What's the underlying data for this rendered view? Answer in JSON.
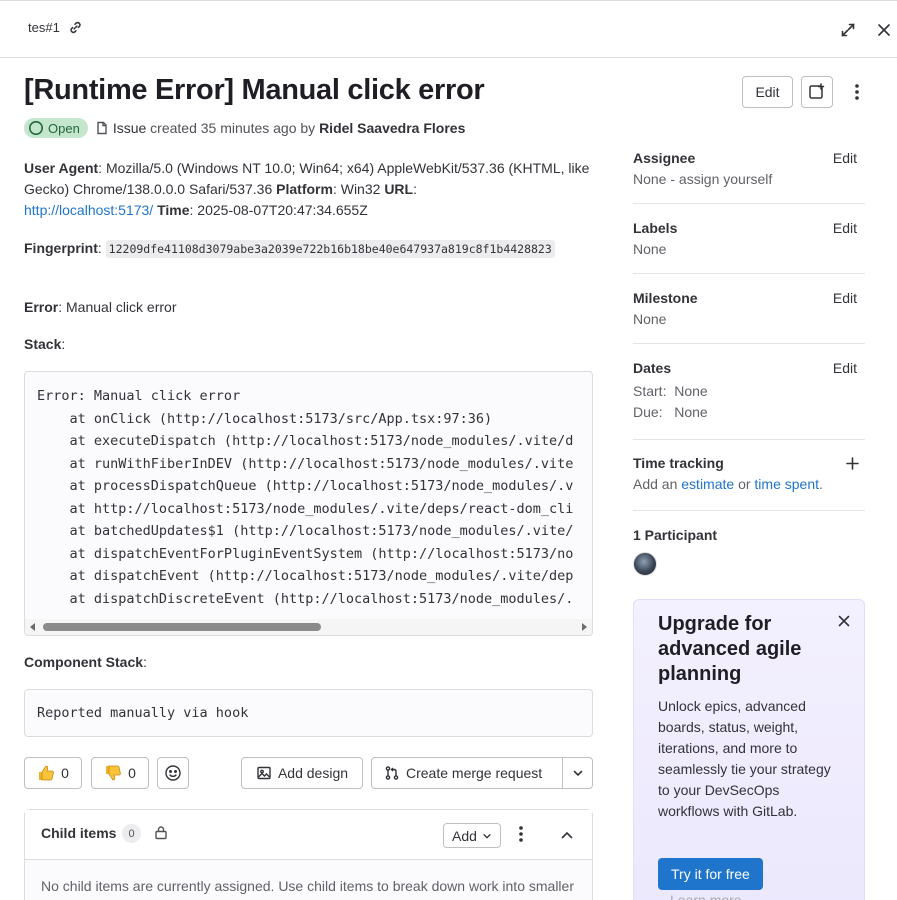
{
  "breadcrumb": {
    "ref": "tes#1"
  },
  "issue": {
    "title": "[Runtime Error] Manual click error",
    "status": "Open",
    "type": "Issue",
    "created_text": "created 35 minutes ago by",
    "author": "Ridel Saavedra Flores"
  },
  "header_buttons": {
    "edit": "Edit"
  },
  "description": {
    "ua_label": "User Agent",
    "ua_value": ": Mozilla/5.0 (Windows NT 10.0; Win64; x64) AppleWebKit/537.36 (KHTML, like Gecko) Chrome/138.0.0.0 Safari/537.36 ",
    "platform_label": "Platform",
    "platform_value": ": Win32 ",
    "url_label": "URL",
    "url_value": "http://localhost:5173/",
    "time_label": "Time",
    "time_value": ": 2025-08-07T20:47:34.655Z",
    "fingerprint_label": "Fingerprint",
    "fingerprint_value": "12209dfe41108d3079abe3a2039e722b16b18be40e647937a819c8f1b4428823",
    "error_label": "Error",
    "error_value": ": Manual click error",
    "stack_label": "Stack",
    "stack_lines": [
      "Error: Manual click error",
      "    at onClick (http://localhost:5173/src/App.tsx:97:36)",
      "    at executeDispatch (http://localhost:5173/node_modules/.vite/d",
      "    at runWithFiberInDEV (http://localhost:5173/node_modules/.vite",
      "    at processDispatchQueue (http://localhost:5173/node_modules/.v",
      "    at http://localhost:5173/node_modules/.vite/deps/react-dom_cli",
      "    at batchedUpdates$1 (http://localhost:5173/node_modules/.vite/",
      "    at dispatchEventForPluginEventSystem (http://localhost:5173/no",
      "    at dispatchEvent (http://localhost:5173/node_modules/.vite/dep",
      "    at dispatchDiscreteEvent (http://localhost:5173/node_modules/."
    ],
    "component_stack_label": "Component Stack",
    "component_stack_value": "Reported manually via hook"
  },
  "actions": {
    "thumbs_up_count": "0",
    "thumbs_down_count": "0",
    "add_design": "Add design",
    "create_mr": "Create merge request"
  },
  "child_items": {
    "title": "Child items",
    "count": "0",
    "add": "Add",
    "empty_text": "No child items are currently assigned. Use child items to break down work into smaller parts."
  },
  "sidebar": {
    "edit": "Edit",
    "assignee": {
      "title": "Assignee",
      "value": "None - assign yourself"
    },
    "labels": {
      "title": "Labels",
      "value": "None"
    },
    "milestone": {
      "title": "Milestone",
      "value": "None"
    },
    "dates": {
      "title": "Dates",
      "start_label": "Start:",
      "start_value": "None",
      "due_label": "Due:",
      "due_value": "None"
    },
    "time_tracking": {
      "title": "Time tracking",
      "prefix": "Add an",
      "estimate": "estimate",
      "or": "or",
      "spent": "time spent",
      "suffix": "."
    },
    "participants": {
      "title": "1 Participant"
    }
  },
  "promo": {
    "title": "Upgrade for advanced agile planning",
    "body": "Unlock epics, advanced boards, status, weight, iterations, and more to seamlessly tie your strategy to your DevSecOps workflows with GitLab.",
    "cta": "Try it for free",
    "learn_more": "Learn more"
  },
  "colors": {
    "accent": "#1f75cb",
    "open_bg": "#c3e6cd",
    "open_fg": "#24663b"
  }
}
